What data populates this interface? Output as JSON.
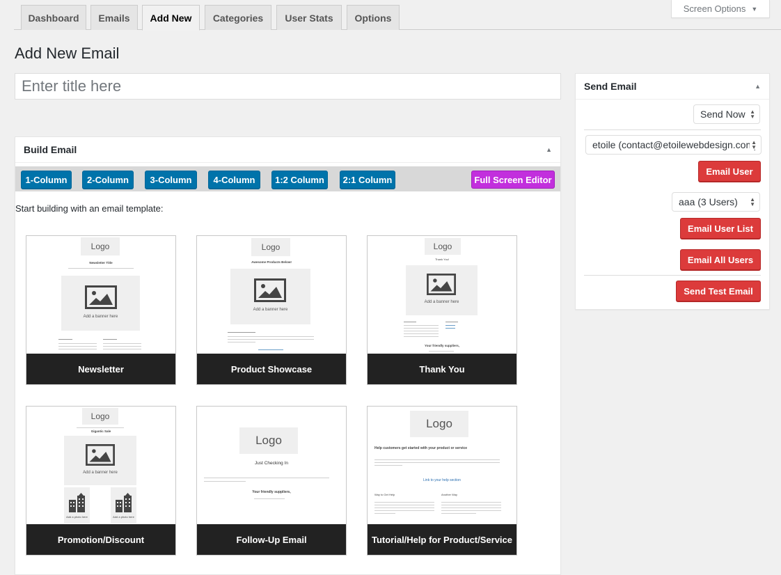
{
  "tabs": [
    {
      "label": "Dashboard",
      "active": false
    },
    {
      "label": "Emails",
      "active": false
    },
    {
      "label": "Add New",
      "active": true
    },
    {
      "label": "Categories",
      "active": false
    },
    {
      "label": "User Stats",
      "active": false
    },
    {
      "label": "Options",
      "active": false
    }
  ],
  "screen_options": {
    "label": "Screen Options",
    "icon": "triangle-down-icon"
  },
  "page_title": "Add New Email",
  "title_input": {
    "value": "",
    "placeholder": "Enter title here"
  },
  "build_email": {
    "title": "Build Email",
    "toggle_icon": "triangle-up-icon",
    "column_buttons": [
      "1-Column",
      "2-Column",
      "3-Column",
      "4-Column",
      "1:2 Column",
      "2:1 Column"
    ],
    "full_screen_label": "Full Screen Editor",
    "start_text": "Start building with an email template:",
    "templates": [
      {
        "name": "Newsletter",
        "heading": "Newsletter Title",
        "banner": "Add a banner here",
        "logo": "Logo"
      },
      {
        "name": "Product Showcase",
        "heading": "Awesome Products Below!",
        "banner": "Add a banner here",
        "logo": "Logo",
        "link": "Link to your collection"
      },
      {
        "name": "Thank You",
        "heading": "Thank You!",
        "banner": "Add a banner here",
        "logo": "Logo",
        "signoff": "Your friendly suppliers,"
      },
      {
        "name": "Promotion/Discount",
        "heading": "Gigantic Sale",
        "banner": "Add a banner here",
        "logo": "Logo",
        "photo": "Add a photo here"
      },
      {
        "name": "Follow-Up Email",
        "heading": "Just Checking In",
        "logo": "Logo",
        "signoff": "Your friendly suppliers,"
      },
      {
        "name": "Tutorial/Help for Product/Service",
        "heading": "Help customers get started with your product or service",
        "logo": "Logo",
        "link": "Link to your help section",
        "col1": "Way to Get Help",
        "col2": "Another Way"
      }
    ]
  },
  "send_email": {
    "title": "Send Email",
    "toggle_icon": "triangle-up-icon",
    "send_timing": "Send Now",
    "user_select": "etoile (contact@etoilewebdesign.com)",
    "email_user_label": "Email User",
    "list_select": "aaa (3 Users)",
    "email_user_list_label": "Email User List",
    "email_all_users_label": "Email All Users",
    "send_test_label": "Send Test Email"
  },
  "colors": {
    "primary_button": "#0073aa",
    "full_screen_button": "#c22fdd",
    "send_button": "#dc3b3b",
    "template_label_bg": "#222222"
  }
}
